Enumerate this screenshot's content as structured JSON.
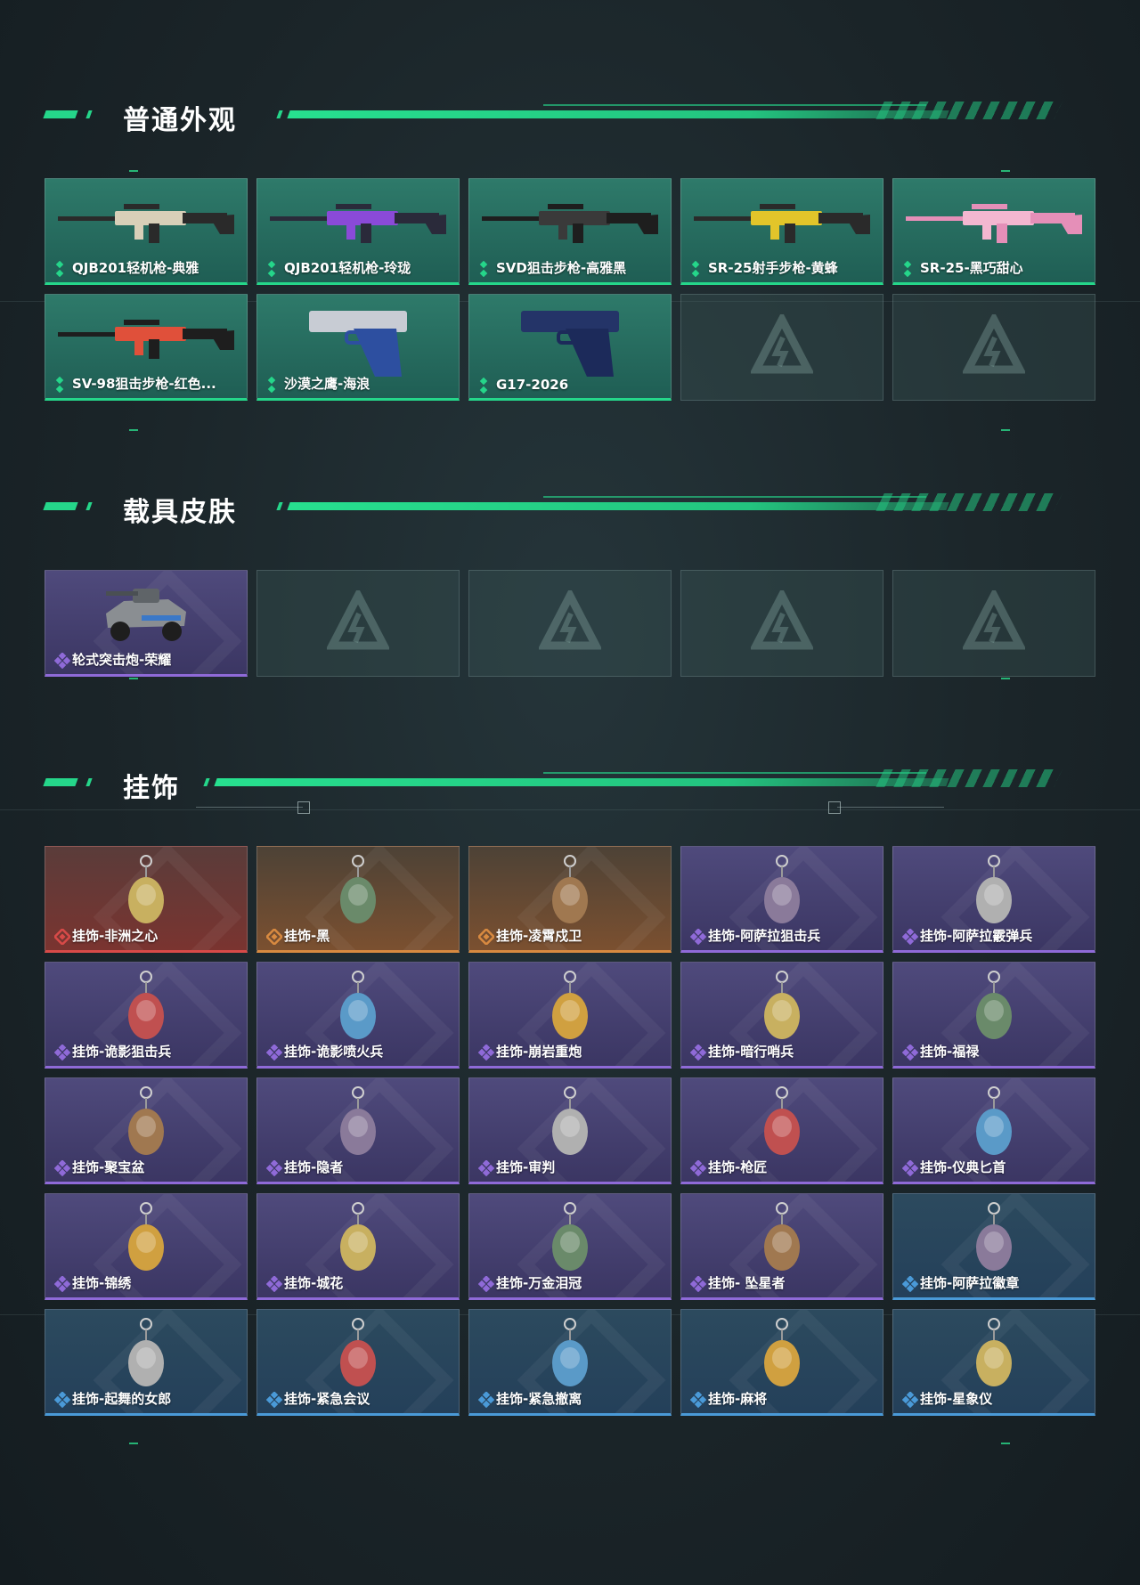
{
  "sections": {
    "weapons": {
      "title": "普通外观"
    },
    "vehicles": {
      "title": "载具皮肤"
    },
    "charms": {
      "title": "挂饰"
    }
  },
  "colors": {
    "accent": "#25d68a",
    "green_rarity": "#25d68a",
    "purple_rarity": "#8f6ad8",
    "red_rarity": "#d84a48",
    "orange_rarity": "#d88a40",
    "blue_rarity": "#4a9ad8"
  },
  "weapon_items": [
    {
      "name": "QJB201轻机枪-典雅",
      "rarity": "green",
      "art": "rifle-beige"
    },
    {
      "name": "QJB201轻机枪-玲珑",
      "rarity": "green",
      "art": "rifle-purple"
    },
    {
      "name": "SVD狙击步枪-高雅黑",
      "rarity": "green",
      "art": "rifle-black"
    },
    {
      "name": "SR-25射手步枪-黄蜂",
      "rarity": "green",
      "art": "rifle-yellow"
    },
    {
      "name": "SR-25-黑巧甜心",
      "rarity": "green",
      "art": "rifle-pink"
    },
    {
      "name": "SV-98狙击步枪-红色...",
      "rarity": "green",
      "art": "rifle-red"
    },
    {
      "name": "沙漠之鹰-海浪",
      "rarity": "green",
      "art": "pistol-blue"
    },
    {
      "name": "G17-2026",
      "rarity": "green",
      "art": "pistol-navy"
    },
    {
      "name": "",
      "rarity": "empty"
    },
    {
      "name": "",
      "rarity": "empty"
    }
  ],
  "vehicle_items": [
    {
      "name": "轮式突击炮-荣耀",
      "rarity": "purple",
      "art": "vehicle"
    },
    {
      "name": "",
      "rarity": "empty"
    },
    {
      "name": "",
      "rarity": "empty"
    },
    {
      "name": "",
      "rarity": "empty"
    },
    {
      "name": "",
      "rarity": "empty"
    }
  ],
  "charm_items": [
    {
      "name": "挂饰-非洲之心",
      "rarity": "red"
    },
    {
      "name": "挂饰-黑",
      "rarity": "orange"
    },
    {
      "name": "挂饰-凌霄戍卫",
      "rarity": "orange"
    },
    {
      "name": "挂饰-阿萨拉狙击兵",
      "rarity": "purple"
    },
    {
      "name": "挂饰-阿萨拉霰弹兵",
      "rarity": "purple"
    },
    {
      "name": "挂饰-诡影狙击兵",
      "rarity": "purple"
    },
    {
      "name": "挂饰-诡影喷火兵",
      "rarity": "purple"
    },
    {
      "name": "挂饰-崩岩重炮",
      "rarity": "purple"
    },
    {
      "name": "挂饰-暗行哨兵",
      "rarity": "purple"
    },
    {
      "name": "挂饰-福禄",
      "rarity": "purple"
    },
    {
      "name": "挂饰-聚宝盆",
      "rarity": "purple"
    },
    {
      "name": "挂饰-隐者",
      "rarity": "purple"
    },
    {
      "name": "挂饰-审判",
      "rarity": "purple"
    },
    {
      "name": "挂饰-枪匠",
      "rarity": "purple"
    },
    {
      "name": "挂饰-仪典匕首",
      "rarity": "purple"
    },
    {
      "name": "挂饰-锦绣",
      "rarity": "purple"
    },
    {
      "name": "挂饰-城花",
      "rarity": "purple"
    },
    {
      "name": "挂饰-万金泪冠",
      "rarity": "purple"
    },
    {
      "name": "挂饰- 坠星者",
      "rarity": "purple"
    },
    {
      "name": "挂饰-阿萨拉徽章",
      "rarity": "blue"
    },
    {
      "name": "挂饰-起舞的女郎",
      "rarity": "blue"
    },
    {
      "name": "挂饰-紧急会议",
      "rarity": "blue"
    },
    {
      "name": "挂饰-紧急撤离",
      "rarity": "blue"
    },
    {
      "name": "挂饰-麻将",
      "rarity": "blue"
    },
    {
      "name": "挂饰-星象仪",
      "rarity": "blue"
    }
  ]
}
